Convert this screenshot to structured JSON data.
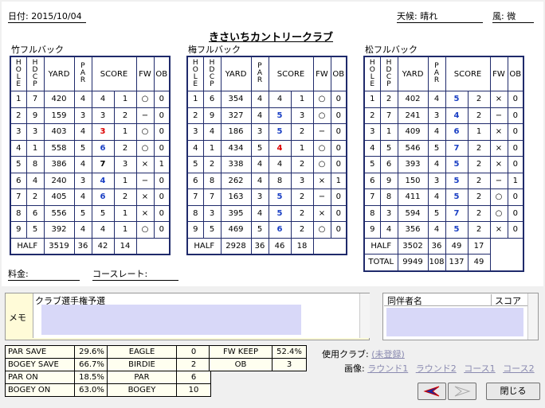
{
  "header": {
    "date": "日付: 2015/10/04",
    "weather": "天候: 晴れ",
    "wind": "風: 微",
    "title": "きさいちカントリークラブ"
  },
  "courses": [
    {
      "name": "竹フルバック",
      "half_label": "HALF",
      "half_yard": "3519",
      "half_par": "36",
      "half_score": "42",
      "half_putts": "14",
      "rows": [
        [
          "1",
          "7",
          "420",
          "4",
          "4",
          "1",
          "○",
          "0",
          ""
        ],
        [
          "2",
          "9",
          "159",
          "3",
          "3",
          "2",
          "−",
          "0",
          ""
        ],
        [
          "3",
          "3",
          "403",
          "4",
          "3",
          "1",
          "○",
          "0",
          "r"
        ],
        [
          "4",
          "1",
          "558",
          "5",
          "6",
          "2",
          "○",
          "0",
          "b"
        ],
        [
          "5",
          "8",
          "386",
          "4",
          "7",
          "3",
          "×",
          "1",
          "k"
        ],
        [
          "6",
          "4",
          "240",
          "3",
          "4",
          "1",
          "−",
          "0",
          "b"
        ],
        [
          "7",
          "2",
          "405",
          "4",
          "6",
          "2",
          "×",
          "0",
          "b"
        ],
        [
          "8",
          "6",
          "556",
          "5",
          "5",
          "1",
          "×",
          "0",
          ""
        ],
        [
          "9",
          "5",
          "392",
          "4",
          "4",
          "1",
          "○",
          "0",
          ""
        ]
      ]
    },
    {
      "name": "梅フルバック",
      "half_label": "HALF",
      "half_yard": "2928",
      "half_par": "36",
      "half_score": "46",
      "half_putts": "18",
      "rows": [
        [
          "1",
          "6",
          "354",
          "4",
          "4",
          "1",
          "○",
          "0",
          ""
        ],
        [
          "2",
          "9",
          "327",
          "4",
          "5",
          "3",
          "○",
          "0",
          "b"
        ],
        [
          "3",
          "4",
          "186",
          "3",
          "5",
          "2",
          "−",
          "0",
          "b"
        ],
        [
          "4",
          "1",
          "434",
          "5",
          "4",
          "1",
          "○",
          "0",
          "r"
        ],
        [
          "5",
          "2",
          "338",
          "4",
          "4",
          "2",
          "○",
          "0",
          ""
        ],
        [
          "6",
          "8",
          "262",
          "4",
          "8",
          "3",
          "×",
          "1",
          ""
        ],
        [
          "7",
          "7",
          "163",
          "3",
          "5",
          "2",
          "−",
          "0",
          "b"
        ],
        [
          "8",
          "3",
          "395",
          "4",
          "5",
          "2",
          "×",
          "0",
          "b"
        ],
        [
          "9",
          "5",
          "469",
          "5",
          "6",
          "2",
          "○",
          "0",
          "b"
        ]
      ]
    },
    {
      "name": "松フルバック",
      "half_label": "HALF",
      "half_yard": "3502",
      "half_par": "36",
      "half_score": "49",
      "half_putts": "17",
      "total_label": "TOTAL",
      "total_yard": "9949",
      "total_par": "108",
      "total_score": "137",
      "total_putts": "49",
      "rows": [
        [
          "1",
          "2",
          "402",
          "4",
          "5",
          "2",
          "×",
          "0",
          "b"
        ],
        [
          "2",
          "7",
          "241",
          "3",
          "4",
          "2",
          "−",
          "0",
          "b"
        ],
        [
          "3",
          "1",
          "409",
          "4",
          "6",
          "1",
          "×",
          "0",
          "b"
        ],
        [
          "4",
          "5",
          "546",
          "5",
          "7",
          "2",
          "×",
          "0",
          "b"
        ],
        [
          "5",
          "6",
          "393",
          "4",
          "5",
          "2",
          "×",
          "0",
          "b"
        ],
        [
          "6",
          "9",
          "150",
          "3",
          "5",
          "2",
          "−",
          "1",
          "b"
        ],
        [
          "7",
          "8",
          "411",
          "4",
          "5",
          "2",
          "○",
          "0",
          "b"
        ],
        [
          "8",
          "3",
          "594",
          "5",
          "7",
          "2",
          "○",
          "0",
          "b"
        ],
        [
          "9",
          "4",
          "356",
          "4",
          "5",
          "2",
          "×",
          "0",
          "b"
        ]
      ]
    }
  ],
  "columns": {
    "hole": "HOLE",
    "hdcp": "HDCP",
    "yard": "YARD",
    "par": "PAR",
    "score": "SCORE",
    "fw": "FW",
    "ob": "OB"
  },
  "fees": {
    "fee_label": "料金:",
    "rating_label": "コースレート:"
  },
  "memo": {
    "label": "メモ",
    "text": "クラブ選手権予選"
  },
  "companions": {
    "name_header": "同伴者名",
    "score_header": "スコア"
  },
  "stats": {
    "left": [
      [
        "PAR SAVE",
        "29.6%"
      ],
      [
        "BOGEY SAVE",
        "66.7%"
      ],
      [
        "PAR ON",
        "18.5%"
      ],
      [
        "BOGEY ON",
        "63.0%"
      ]
    ],
    "mid": [
      [
        "EAGLE",
        "0"
      ],
      [
        "BIRDIE",
        "2"
      ],
      [
        "PAR",
        "6"
      ],
      [
        "BOGEY",
        "10"
      ]
    ],
    "right": [
      [
        "FW KEEP",
        "52.4%"
      ],
      [
        "OB",
        "3"
      ]
    ]
  },
  "footer": {
    "club_label": "使用クラブ:",
    "club_value": "(未登録)",
    "image_label": "画像:",
    "links": [
      "ラウンド1",
      "ラウンド2",
      "コース1",
      "コース2"
    ],
    "close": "閉じる"
  }
}
